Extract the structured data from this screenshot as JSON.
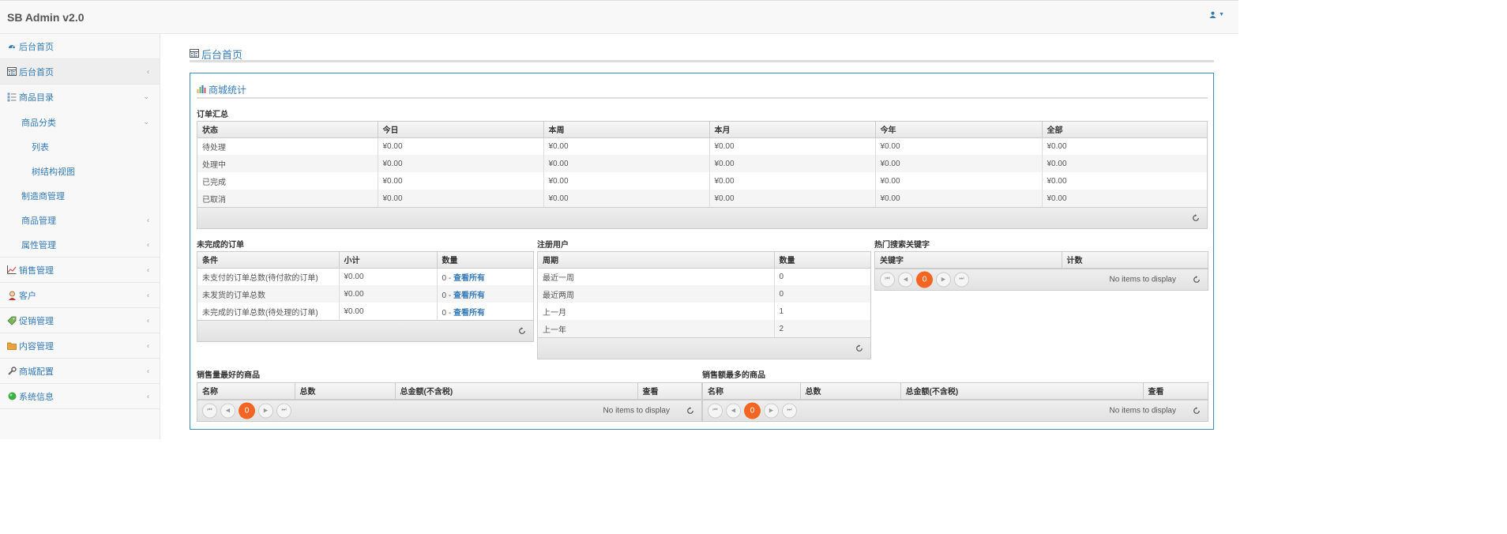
{
  "brand": "SB Admin v2.0",
  "user_menu": {
    "icon": "user-icon"
  },
  "sidebar": {
    "items": [
      {
        "label": "后台首页",
        "icon": "dashboard-icon"
      },
      {
        "label": "后台首页",
        "icon": "table-icon"
      },
      {
        "label": "商品目录",
        "icon": "catalog-icon"
      },
      {
        "label": "商品分类"
      },
      {
        "label": "列表"
      },
      {
        "label": "树结构视图"
      },
      {
        "label": "制造商管理"
      },
      {
        "label": "商品管理"
      },
      {
        "label": "属性管理"
      },
      {
        "label": "销售管理",
        "icon": "sales-chart-icon"
      },
      {
        "label": "客户",
        "icon": "customer-icon"
      },
      {
        "label": "促销管理",
        "icon": "tag-icon"
      },
      {
        "label": "内容管理",
        "icon": "folder-icon"
      },
      {
        "label": "商城配置",
        "icon": "wrench-icon"
      },
      {
        "label": "系统信息",
        "icon": "status-dot-icon"
      }
    ]
  },
  "page_title": "后台首页",
  "panel_title": "商城统计",
  "order_summary": {
    "title": "订单汇总",
    "headers": [
      "状态",
      "今日",
      "本周",
      "本月",
      "今年",
      "全部"
    ],
    "rows": [
      [
        "待处理",
        "¥0.00",
        "¥0.00",
        "¥0.00",
        "¥0.00",
        "¥0.00"
      ],
      [
        "处理中",
        "¥0.00",
        "¥0.00",
        "¥0.00",
        "¥0.00",
        "¥0.00"
      ],
      [
        "已完成",
        "¥0.00",
        "¥0.00",
        "¥0.00",
        "¥0.00",
        "¥0.00"
      ],
      [
        "已取消",
        "¥0.00",
        "¥0.00",
        "¥0.00",
        "¥0.00",
        "¥0.00"
      ]
    ]
  },
  "incomplete_orders": {
    "title": "未完成的订单",
    "headers": [
      "条件",
      "小计",
      "数量"
    ],
    "view_all": "查看所有",
    "rows": [
      {
        "condition": "未支付的订单总数(待付款的订单)",
        "subtotal": "¥0.00",
        "count": "0 - "
      },
      {
        "condition": "未发货的订单总数",
        "subtotal": "¥0.00",
        "count": "0 - "
      },
      {
        "condition": "未完成的订单总数(待处理的订单)",
        "subtotal": "¥0.00",
        "count": "0 - "
      }
    ]
  },
  "registered_users": {
    "title": "注册用户",
    "headers": [
      "周期",
      "数量"
    ],
    "rows": [
      [
        "最近一周",
        "0"
      ],
      [
        "最近两周",
        "0"
      ],
      [
        "上一月",
        "1"
      ],
      [
        "上一年",
        "2"
      ]
    ]
  },
  "hot_keywords": {
    "title": "热门搜索关键字",
    "headers": [
      "关键字",
      "计数"
    ],
    "empty": "No items to display",
    "page": "0"
  },
  "best_qty": {
    "title": "销售量最好的商品",
    "headers": [
      "名称",
      "总数",
      "总金额(不含税)",
      "查看"
    ],
    "empty": "No items to display",
    "page": "0"
  },
  "best_amount": {
    "title": "销售额最多的商品",
    "headers": [
      "名称",
      "总数",
      "总金额(不含税)",
      "查看"
    ],
    "empty": "No items to display",
    "page": "0"
  },
  "colors": {
    "accent": "#337ab7",
    "pager_current": "#f26522",
    "panel_border": "#3c8dbc"
  }
}
